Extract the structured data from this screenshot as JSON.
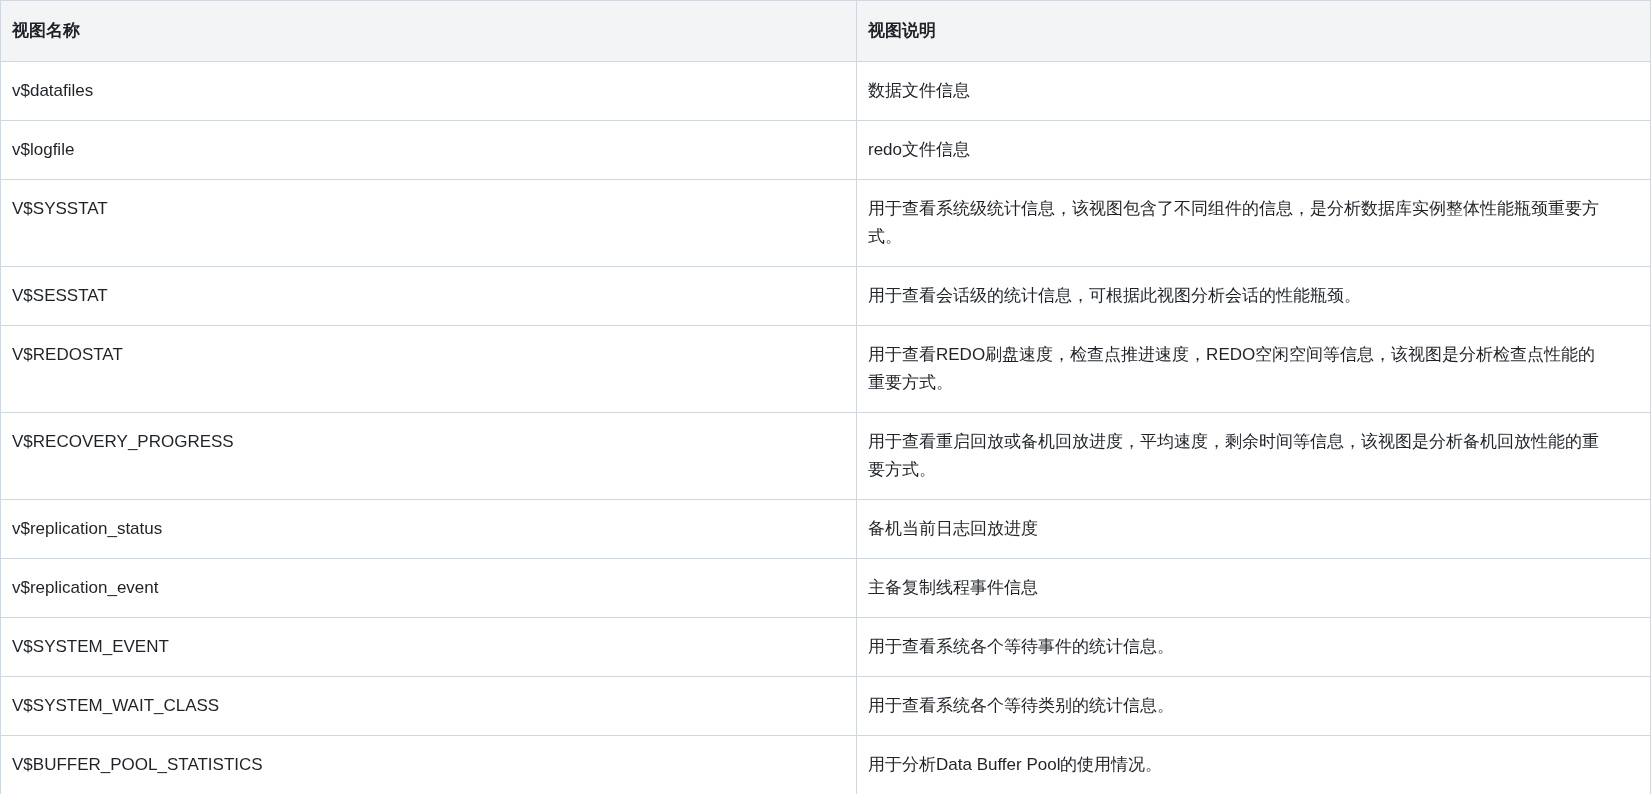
{
  "table": {
    "columns": [
      "视图名称",
      "视图说明"
    ],
    "rows": [
      [
        "v$datafiles",
        "数据文件信息"
      ],
      [
        "v$logfile",
        "redo文件信息"
      ],
      [
        "V$SYSSTAT",
        "用于查看系统级统计信息，该视图包含了不同组件的信息，是分析数据库实例整体性能瓶颈重要方式。"
      ],
      [
        "V$SESSTAT",
        "用于查看会话级的统计信息，可根据此视图分析会话的性能瓶颈。"
      ],
      [
        "V$REDOSTAT",
        "用于查看REDO刷盘速度，检查点推进速度，REDO空闲空间等信息，该视图是分析检查点性能的重要方式。"
      ],
      [
        "V$RECOVERY_PROGRESS",
        "用于查看重启回放或备机回放进度，平均速度，剩余时间等信息，该视图是分析备机回放性能的重要方式。"
      ],
      [
        "v$replication_status",
        "备机当前日志回放进度"
      ],
      [
        "v$replication_event",
        "主备复制线程事件信息"
      ],
      [
        "V$SYSTEM_EVENT",
        "用于查看系统各个等待事件的统计信息。"
      ],
      [
        "V$SYSTEM_WAIT_CLASS",
        "用于查看系统各个等待类别的统计信息。"
      ],
      [
        "V$BUFFER_POOL_STATISTICS",
        "用于分析Data Buffer Pool的使用情况。"
      ]
    ]
  }
}
